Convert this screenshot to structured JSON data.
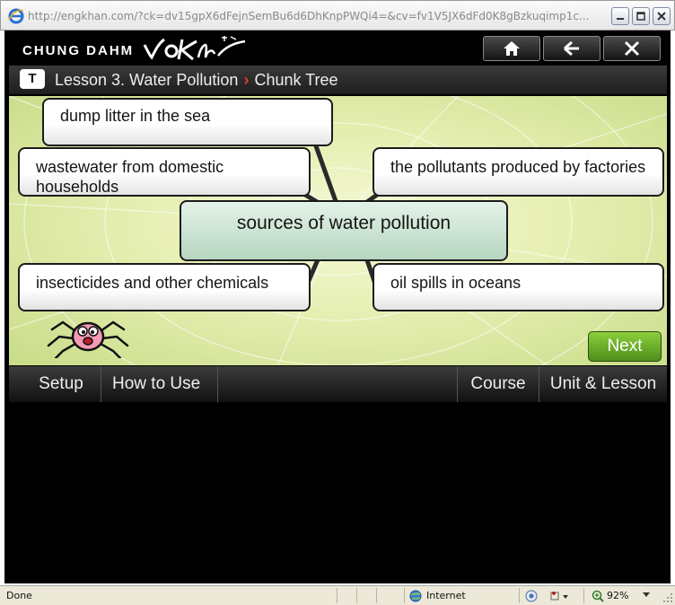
{
  "browser": {
    "url_title": "http://engkhan.com/?ck=dv15gpX6dFejnSemBu6d6DhKnpPWQi4=&cv=fv1V5JX6dFd0K8gBzkuqimp1c...",
    "status_text": "Done",
    "zone_text": "Internet",
    "zoom_text": "92%"
  },
  "header": {
    "brand_text": "CHUNG DAHM",
    "brand_logo_text": "voKhan"
  },
  "breadcrumb": {
    "badge": "T",
    "lesson": "Lesson 3. Water Pollution",
    "separator": "›",
    "page": "Chunk Tree"
  },
  "chunk_tree": {
    "center": "sources of water pollution",
    "chunks": [
      "dump litter in the sea",
      "wastewater from domestic households",
      "the pollutants produced by factories",
      "insecticides and other chemicals",
      "oil spills in oceans"
    ]
  },
  "next_label": "Next",
  "nav": {
    "setup": "Setup",
    "how_to_use": "How to Use",
    "course": "Course",
    "unit_lesson": "Unit & Lesson"
  },
  "colors": {
    "accent_green": "#5fa126",
    "breadcrumb_arrow": "#e23a2a"
  }
}
